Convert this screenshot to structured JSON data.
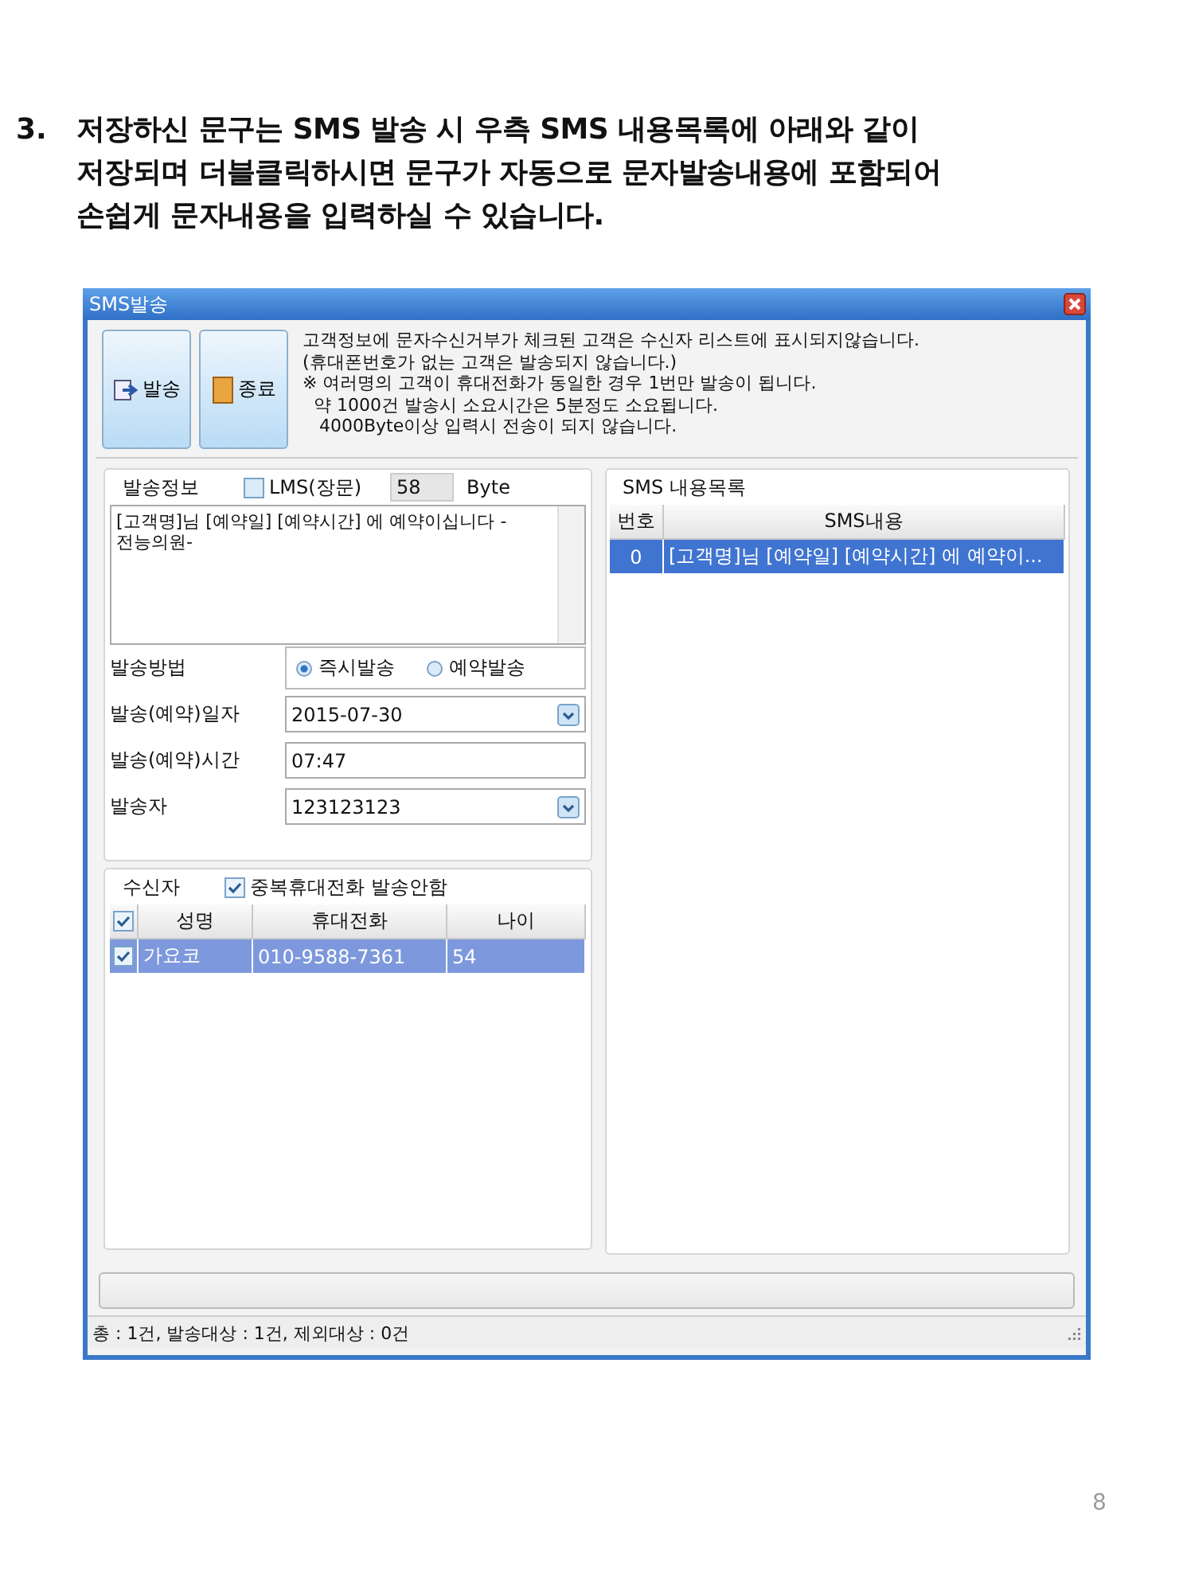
{
  "heading": {
    "number": "3.",
    "lines": [
      "저장하신 문구는 SMS 발송 시 우측 SMS 내용목록에 아래와 같이",
      "저장되며 더블클릭하시면 문구가 자동으로 문자발송내용에 포함되어",
      "손쉽게 문자내용을 입력하실 수 있습니다."
    ]
  },
  "window": {
    "title": "SMS발송"
  },
  "toolbar": {
    "buttons": [
      {
        "label": "발송",
        "kind": "send"
      },
      {
        "label": "종료",
        "kind": "exit"
      }
    ],
    "notice": [
      "고객정보에 문자수신거부가 체크된 고객은 수신자 리스트에 표시되지않습니다.",
      "(휴대폰번호가 없는 고객은 발송되지 않습니다.)",
      "※ 여러명의 고객이 휴대전화가 동일한 경우 1번만 발송이 됩니다.",
      "  약 1000건 발송시 소요시간은 5분정도 소요됩니다.",
      "   4000Byte이상 입력시 전송이 되지 않습니다."
    ]
  },
  "send_info": {
    "title": "발송정보",
    "lms": {
      "label": "LMS(장문)",
      "checked": false
    },
    "byte_count": "58",
    "byte_unit": "Byte",
    "message": "[고객명]님 [예약일] [예약시간] 에 예약이십니다 -\n전능의원-",
    "method": {
      "label": "발송방법",
      "options": [
        {
          "label": "즉시발송",
          "selected": true
        },
        {
          "label": "예약발송",
          "selected": false
        }
      ]
    },
    "fields": [
      {
        "label": "발송(예약)일자",
        "value": "2015-07-30",
        "kind": "dropdown"
      },
      {
        "label": "발송(예약)시간",
        "value": "07:47",
        "kind": "text"
      },
      {
        "label": "발송자",
        "value": "123123123",
        "kind": "dropdown"
      }
    ]
  },
  "recipients": {
    "title": "수신자",
    "dedupe": {
      "label": "중복휴대전화 발송안함",
      "checked": true
    },
    "all_checked": true,
    "columns": [
      "성명",
      "휴대전화",
      "나이"
    ],
    "rows": [
      {
        "checked": true,
        "selected": true,
        "cells": [
          "가요코",
          "010-9588-7361",
          "54"
        ]
      }
    ]
  },
  "sms_list": {
    "title": "SMS 내용목록",
    "columns": [
      "번호",
      "SMS내용"
    ],
    "rows": [
      {
        "selected": true,
        "cells": [
          "0",
          "[고객명]님 [예약일] [예약시간] 에 예약이..."
        ]
      }
    ]
  },
  "progress": {
    "level": 0
  },
  "status_bar": "총 : 1건, 발송대상 : 1건, 제외대상 : 0건",
  "page_number": "8"
}
